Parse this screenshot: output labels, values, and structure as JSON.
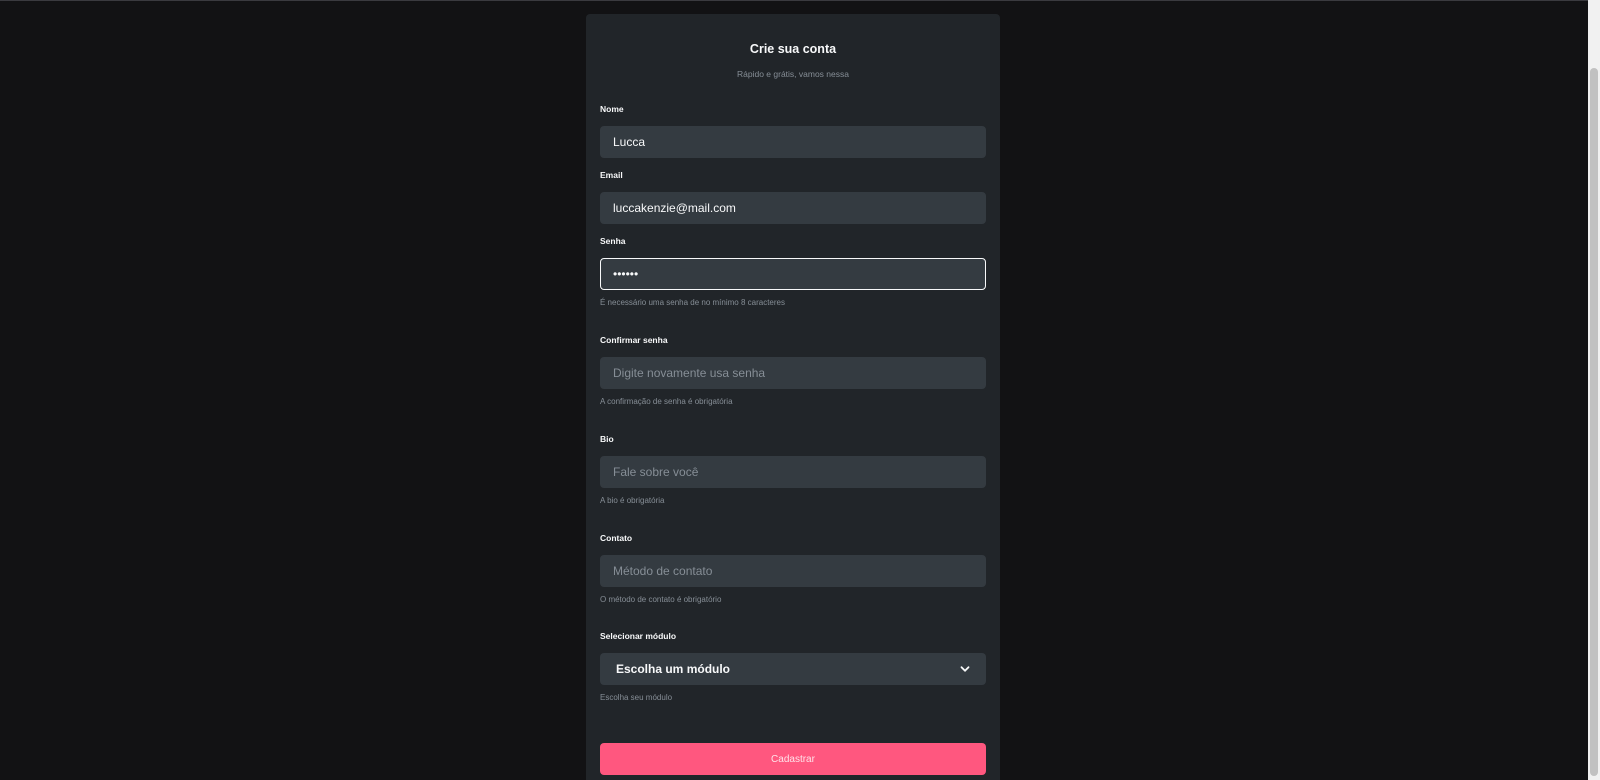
{
  "form": {
    "title": "Crie sua conta",
    "subtitle": "Rápido e grátis, vamos nessa",
    "name": {
      "label": "Nome",
      "value": "Lucca"
    },
    "email": {
      "label": "Email",
      "value": "luccakenzie@mail.com"
    },
    "password": {
      "label": "Senha",
      "value": "123456",
      "helper": "É necessário uma senha de no mínimo 8 caracteres"
    },
    "confirm_password": {
      "label": "Confirmar senha",
      "placeholder": "Digite novamente usa senha",
      "helper": "A confirmação de senha é obrigatória"
    },
    "bio": {
      "label": "Bio",
      "placeholder": "Fale sobre você",
      "helper": "A bio é obrigatória"
    },
    "contact": {
      "label": "Contato",
      "placeholder": "Método de contato",
      "helper": "O método de contato é obrigatório"
    },
    "module": {
      "label": "Selecionar módulo",
      "selected": "Escolha um módulo",
      "helper": "Escolha seu módulo"
    },
    "submit_label": "Cadastrar"
  },
  "colors": {
    "background": "#121214",
    "card": "#212529",
    "input": "#343b41",
    "primary": "#ff577f",
    "text": "#f8f9fa",
    "muted": "#868e96"
  },
  "icons": {
    "select_arrow": "chevron-down-icon"
  }
}
